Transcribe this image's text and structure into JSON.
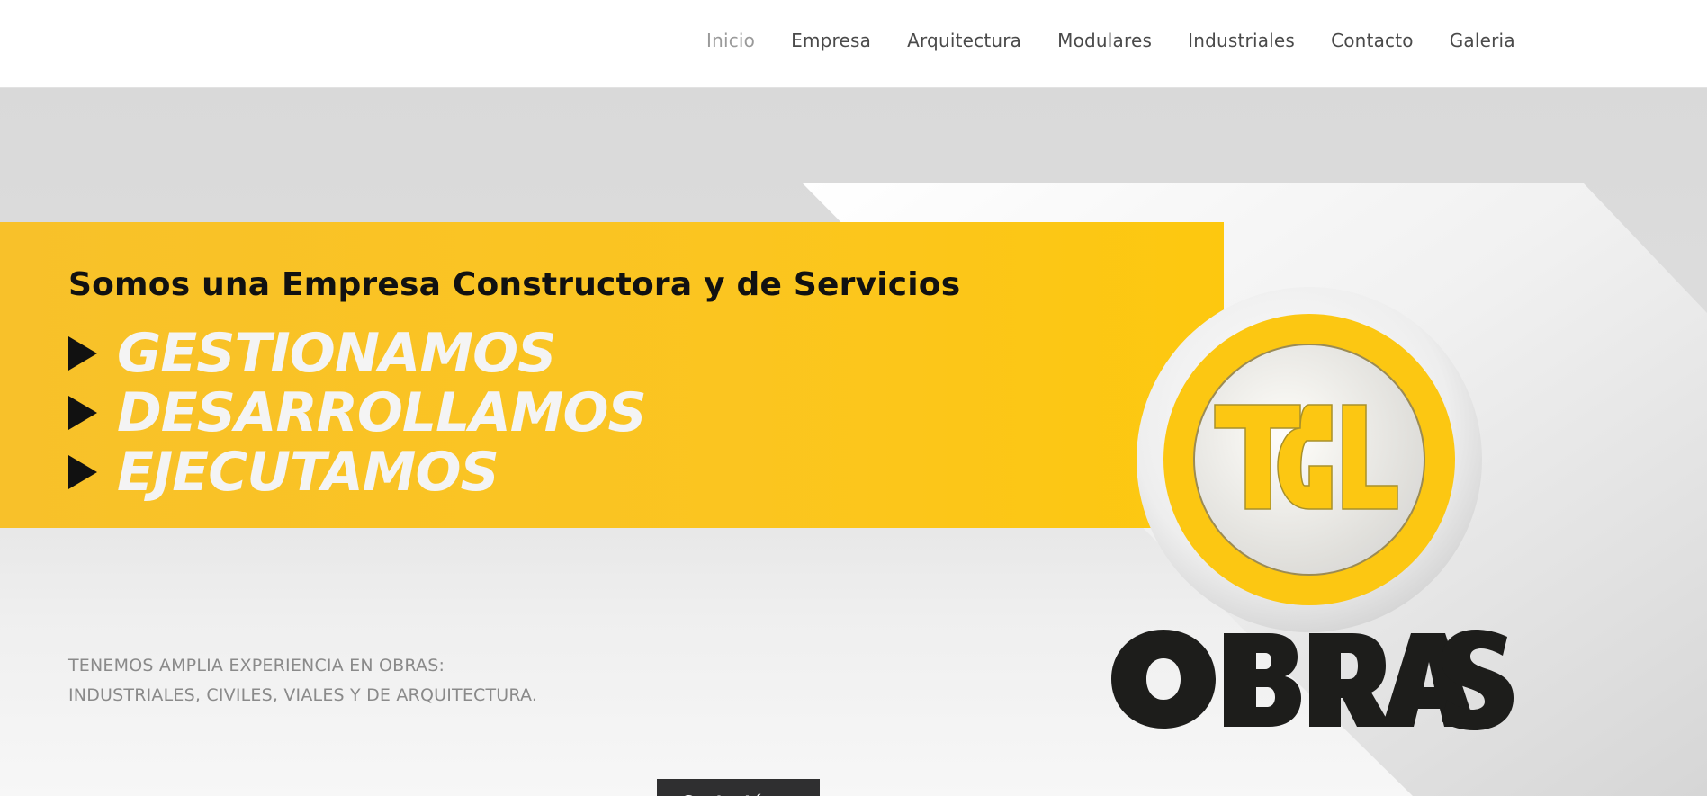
{
  "nav": {
    "items": [
      {
        "label": "Inicio",
        "active": true
      },
      {
        "label": "Empresa"
      },
      {
        "label": "Arquitectura"
      },
      {
        "label": "Modulares"
      },
      {
        "label": "Industriales"
      },
      {
        "label": "Contacto"
      },
      {
        "label": "Galeria"
      }
    ]
  },
  "hero": {
    "tagline": "Somos una Empresa Constructora y de Servicios",
    "verbs": [
      "GESTIONAMOS",
      "DESARROLLAMOS",
      "EJECUTAMOS"
    ],
    "experience_lines": [
      "TENEMOS AMPLIA EXPERIENCIA EN OBRAS:",
      "INDUSTRIALES, CIVILES, VIALES Y DE ARQUITECTURA."
    ],
    "cta_label": "Contactános"
  },
  "logo": {
    "monogram": "TGL",
    "wordmark": "OBRAS"
  },
  "colors": {
    "brand_yellow": "#fcc712",
    "dark": "#1d1d1b",
    "button": "#2f2f30"
  }
}
